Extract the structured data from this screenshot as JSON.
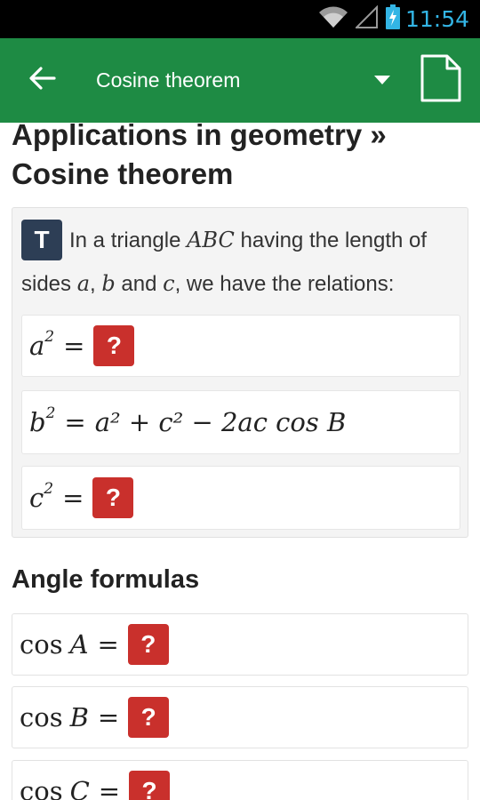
{
  "status_bar": {
    "time": "11:54",
    "icons": [
      "wifi-icon",
      "signal-icon",
      "battery-charging-icon"
    ]
  },
  "app_bar": {
    "title": "Cosine theorem",
    "icons": [
      "back-arrow-icon",
      "dropdown-triangle-icon",
      "document-icon"
    ]
  },
  "page": {
    "title": "Applications in geometry » Cosine theorem",
    "theorem": {
      "badge": "T",
      "text_before": "In a triangle",
      "triangle_name": "ABC",
      "text_after": "having the length of sides",
      "side_a": "a",
      "sep1": ",",
      "side_b": "b",
      "and": "and",
      "side_c": "c",
      "text_end": ", we have the relations:",
      "formulas": [
        {
          "lhs_base": "a",
          "lhs_exp": "2",
          "rhs": "?"
        },
        {
          "lhs_base": "b",
          "lhs_exp": "2",
          "rhs": "a² + c² − 2ac cos B"
        },
        {
          "lhs_base": "c",
          "lhs_exp": "2",
          "rhs": "?"
        }
      ]
    },
    "angle_section": {
      "title": "Angle formulas",
      "items": [
        {
          "fn": "cos",
          "var": "A",
          "eq": "=",
          "answer": "?"
        },
        {
          "fn": "cos",
          "var": "B",
          "eq": "=",
          "answer": "?"
        },
        {
          "fn": "cos",
          "var": "C",
          "eq": "=",
          "answer": "?"
        }
      ]
    },
    "equals_sign": "="
  },
  "colors": {
    "app_bar": "#1e8b44",
    "status_time": "#33b5e5",
    "theorem_badge": "#2d3e55",
    "reveal_button": "#c9302c"
  }
}
